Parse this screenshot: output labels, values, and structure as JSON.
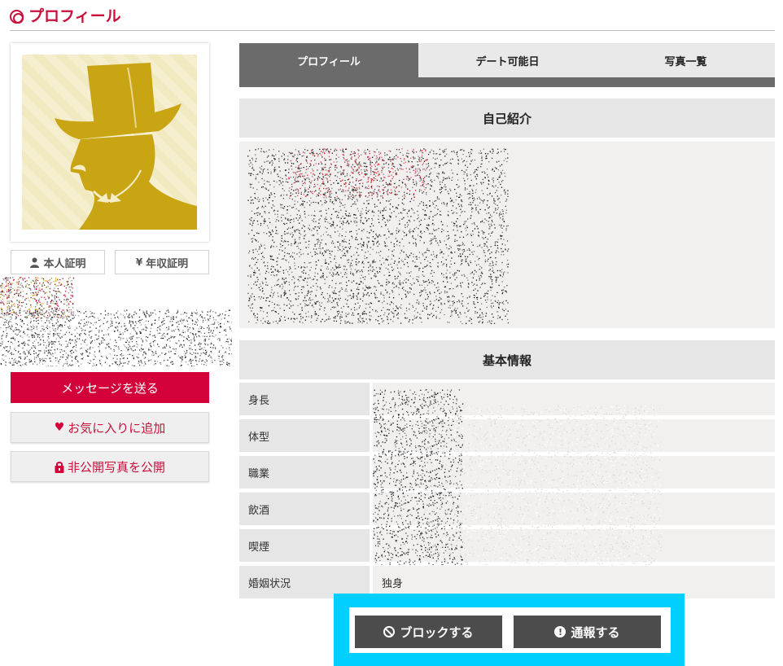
{
  "header": {
    "title": "プロフィール",
    "icon": "double-circle-icon",
    "accent": "#c8103c"
  },
  "avatar": {
    "icon": "gentleman-silhouette-icon"
  },
  "verifications": [
    {
      "label": "本人証明",
      "icon": "person-icon"
    },
    {
      "label": "年収証明",
      "icon": "yen-icon",
      "glyph": "¥"
    }
  ],
  "actions": {
    "message": "メッセージを送る",
    "favorite": "お気に入りに追加",
    "favorite_icon": "heart-icon",
    "private_photos": "非公開写真を公開",
    "private_icon": "lock-icon"
  },
  "tabs": [
    {
      "label": "プロフィール",
      "active": true
    },
    {
      "label": "デート可能日",
      "active": false
    },
    {
      "label": "写真一覧",
      "active": false
    }
  ],
  "intro": {
    "heading": "自己紹介"
  },
  "basic_info": {
    "heading": "基本情報",
    "rows": [
      {
        "label": "身長",
        "value": ""
      },
      {
        "label": "体型",
        "value": ""
      },
      {
        "label": "職業",
        "value": ""
      },
      {
        "label": "飲酒",
        "value": ""
      },
      {
        "label": "喫煙",
        "value": ""
      },
      {
        "label": "婚姻状況",
        "value": "独身"
      }
    ]
  },
  "footer": {
    "block": "ブロックする",
    "block_icon": "block-icon",
    "report": "通報する",
    "report_icon": "exclamation-icon",
    "highlight_color": "#00cfff"
  }
}
